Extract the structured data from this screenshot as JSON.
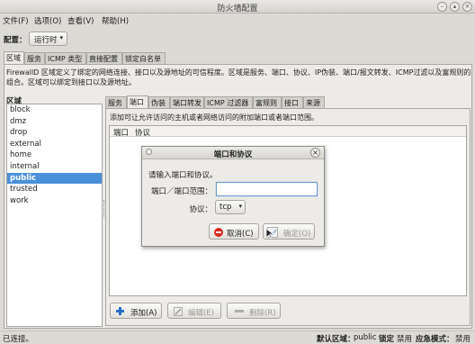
{
  "window": {
    "title": "防火墙配置"
  },
  "menu": {
    "file": "文件(F)",
    "options": "选项(O)",
    "view": "查看(V)",
    "help": "帮助(H)"
  },
  "config": {
    "label": "配置：",
    "value": "运行时"
  },
  "main_tabs": [
    "区域",
    "服务",
    "ICMP 类型",
    "直接配置",
    "锁定白名单"
  ],
  "description": [
    "FirewallD 区域定义了绑定的网络连接、接口以及源地址的可信程度。区域是服务、端口、协议、IP伪装、端口/报文转发、ICMP过滤以及富规则的",
    "组合。区域可以绑定到接口以及源地址。"
  ],
  "zones": {
    "header": "区域",
    "items": [
      "block",
      "dmz",
      "drop",
      "external",
      "home",
      "internal",
      "public",
      "trusted",
      "work"
    ],
    "selected": "public"
  },
  "sub_tabs": [
    "服务",
    "端口",
    "伪装",
    "端口转发",
    "ICMP 过滤器",
    "富规则",
    "接口",
    "来源"
  ],
  "port_panel": {
    "hint": "添加可让允许访问的主机或者网络访问的附加端口或者端口范围。",
    "col_port": "端口",
    "col_protocol": "协议",
    "add": "添加(A)",
    "edit": "编辑(E)",
    "remove": "删除(R)"
  },
  "dialog": {
    "title": "端口和协议",
    "prompt": "请输入端口和协议。",
    "port_label": "端口／端口范围：",
    "port_value": "",
    "protocol_label": "协议：",
    "protocol_value": "tcp",
    "cancel": "取消(C)",
    "ok": "确定(O)"
  },
  "statusbar": {
    "status": "已连接。",
    "default_zone_label": "默认区域：",
    "default_zone_value": "public",
    "lockdown_label": "锁定",
    "lockdown_value": "禁用",
    "panic_label": "应急模式：",
    "panic_value": "禁用"
  },
  "colors": {
    "selection": "#4a90d9",
    "cancel_icon": "#d9281e",
    "add_icon": "#2a6fc4"
  }
}
